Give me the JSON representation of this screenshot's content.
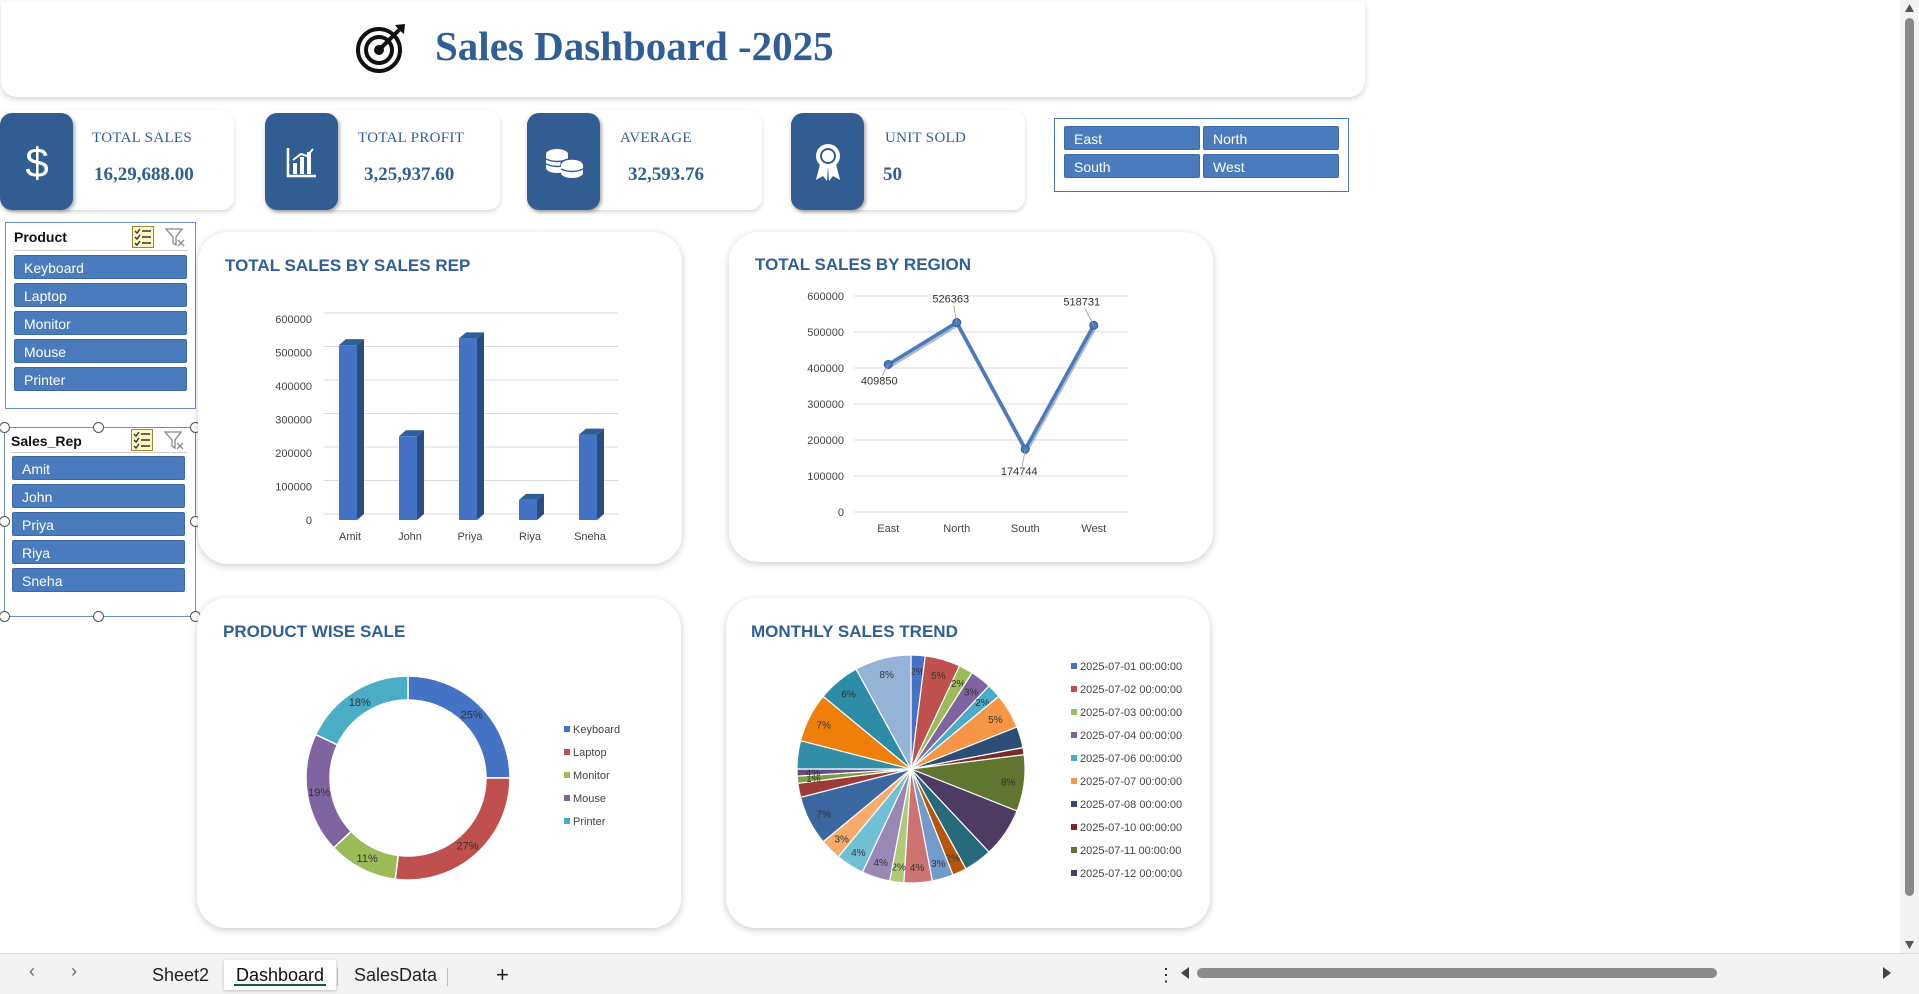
{
  "header": {
    "title": "Sales Dashboard -2025",
    "icon": "target-arrow-icon"
  },
  "kpis": [
    {
      "label": "TOTAL SALES",
      "value": "16,29,688.00",
      "icon": "dollar-icon"
    },
    {
      "label": "TOTAL PROFIT",
      "value": "3,25,937.60",
      "icon": "bar-chart-icon"
    },
    {
      "label": "AVERAGE",
      "value": "32,593.76",
      "icon": "coins-icon"
    },
    {
      "label": "UNIT SOLD",
      "value": "50",
      "icon": "award-ribbon-icon"
    }
  ],
  "region_slicer": {
    "items": [
      "East",
      "North",
      "South",
      "West"
    ]
  },
  "product_slicer": {
    "title": "Product",
    "items": [
      "Keyboard",
      "Laptop",
      "Monitor",
      "Mouse",
      "Printer"
    ]
  },
  "salesrep_slicer": {
    "title": "Sales_Rep",
    "items": [
      "Amit",
      "John",
      "Priya",
      "Riya",
      "Sneha"
    ]
  },
  "colors": {
    "accent": "#2f5f96",
    "tile": "#325d92",
    "slicer_button": "#4a7bbd",
    "series": "#4472c4"
  },
  "chart_data": [
    {
      "type": "bar",
      "title": "TOTAL SALES BY SALES REP",
      "categories": [
        "Amit",
        "John",
        "Priya",
        "Riya",
        "Sneha"
      ],
      "values": [
        522000,
        250000,
        542000,
        60000,
        255000
      ],
      "ylim": [
        0,
        600000
      ],
      "yticks": [
        "0",
        "100000",
        "200000",
        "300000",
        "400000",
        "500000",
        "600000"
      ],
      "grid": true
    },
    {
      "type": "line",
      "title": "TOTAL SALES BY REGION",
      "categories": [
        "East",
        "North",
        "South",
        "West"
      ],
      "values": [
        409850,
        526363,
        174744,
        518731
      ],
      "labels": [
        "409850",
        "526363",
        "174744",
        "518731"
      ],
      "ylim": [
        0,
        600000
      ],
      "yticks": [
        "0",
        "100000",
        "200000",
        "300000",
        "400000",
        "500000",
        "600000"
      ],
      "grid": true
    },
    {
      "type": "pie",
      "title": "PRODUCT WISE SALE",
      "categories": [
        "Keyboard",
        "Laptop",
        "Monitor",
        "Mouse",
        "Printer"
      ],
      "values": [
        25,
        27,
        11,
        19,
        18
      ],
      "labels": [
        "25%",
        "27%",
        "11%",
        "19%",
        "18%"
      ],
      "colors": [
        "#4472c4",
        "#c0504d",
        "#9bbb59",
        "#8064a2",
        "#4bacc6"
      ],
      "legend": "right"
    },
    {
      "type": "pie",
      "title": "MONTHLY SALES TREND",
      "legend_entries": [
        "2025-07-01 00:00:00",
        "2025-07-02 00:00:00",
        "2025-07-03 00:00:00",
        "2025-07-04 00:00:00",
        "2025-07-06 00:00:00",
        "2025-07-07 00:00:00",
        "2025-07-08 00:00:00",
        "2025-07-10 00:00:00",
        "2025-07-11 00:00:00",
        "2025-07-12 00:00:00"
      ],
      "values": [
        2,
        5,
        2,
        3,
        2,
        5,
        3,
        1,
        8,
        7,
        4,
        2,
        3,
        4,
        2,
        4,
        4,
        3,
        7,
        2,
        1,
        1,
        4,
        7,
        6,
        8
      ],
      "labels": [
        "2%",
        "5%",
        "2%",
        "3%",
        "2%",
        "5%",
        "",
        "",
        "8%",
        "",
        "",
        "2%",
        "3%",
        "4%",
        "2%",
        "4%",
        "4%",
        "3%",
        "7%",
        "",
        "1%",
        "4%",
        "",
        "7%",
        "6%",
        "8%"
      ],
      "colors": [
        "#4472c4",
        "#c0504d",
        "#9bbb59",
        "#8064a2",
        "#4bacc6",
        "#f79646",
        "#2c4d75",
        "#772c2a",
        "#5f7530",
        "#4d3b62",
        "#276a7c",
        "#b65708",
        "#729aca",
        "#cd7371",
        "#afc97a",
        "#9a87b5",
        "#6fbfd5",
        "#f9ab6b",
        "#3a67a0",
        "#9d3b38",
        "#7e9c40",
        "#664e83",
        "#338da5",
        "#f07f09",
        "#2d8ca8",
        "#95b3d7"
      ],
      "legend": "right"
    }
  ],
  "tabs": [
    "Sheet2",
    "Dashboard",
    "SalesData"
  ],
  "active_tab": "Dashboard",
  "tabbar": {
    "add": "+",
    "more": "⋮",
    "prev": "‹",
    "next": "›"
  }
}
